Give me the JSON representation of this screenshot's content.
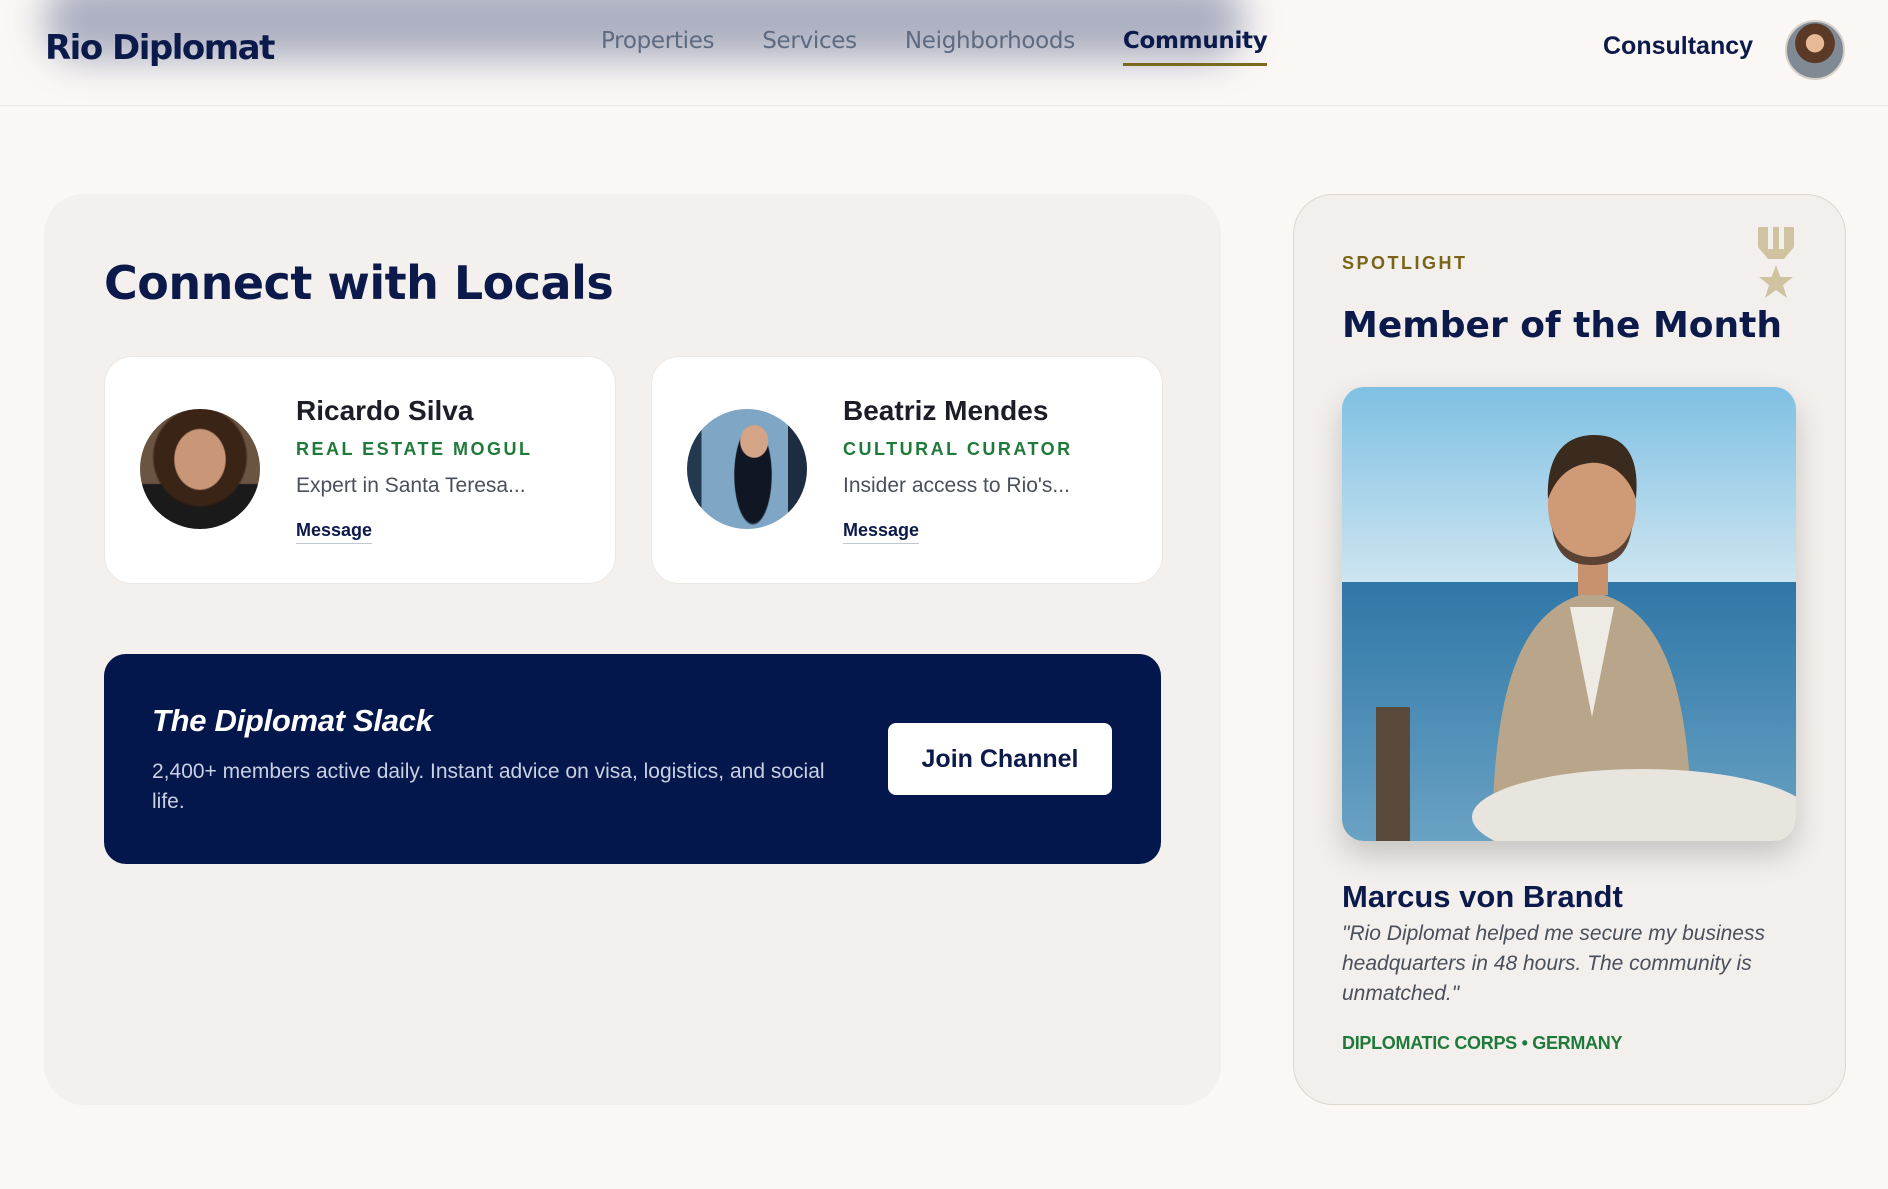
{
  "header": {
    "logo": "Rio Diplomat",
    "nav": [
      {
        "label": "Properties",
        "active": false
      },
      {
        "label": "Services",
        "active": false
      },
      {
        "label": "Neighborhoods",
        "active": false
      },
      {
        "label": "Community",
        "active": true
      }
    ],
    "cta": "Consultancy",
    "avatar_icon": "user-avatar"
  },
  "main": {
    "title": "Connect with Locals",
    "locals": [
      {
        "name": "Ricardo Silva",
        "role": "REAL ESTATE MOGUL",
        "desc": "Expert in Santa Teresa...",
        "action": "Message"
      },
      {
        "name": "Beatriz Mendes",
        "role": "CULTURAL CURATOR",
        "desc": "Insider access to Rio's...",
        "action": "Message"
      }
    ],
    "slack": {
      "title": "The Diplomat Slack",
      "description": "2,400+ members active daily. Instant advice on visa, logistics, and social life.",
      "button": "Join Channel"
    }
  },
  "spotlight": {
    "kicker": "SPOTLIGHT",
    "title": "Member of the Month",
    "icon": "medal-icon",
    "name": "Marcus von Brandt",
    "quote": "\"Rio Diplomat helped me secure my business headquarters in 48 hours. The community is unmatched.\"",
    "meta": "DIPLOMATIC CORPS • GERMANY"
  },
  "colors": {
    "navy": "#0b1a4a",
    "banner": "#03174d",
    "accent_green": "#1f7a3a",
    "accent_gold": "#7a6418",
    "background": "#faf7f5"
  }
}
